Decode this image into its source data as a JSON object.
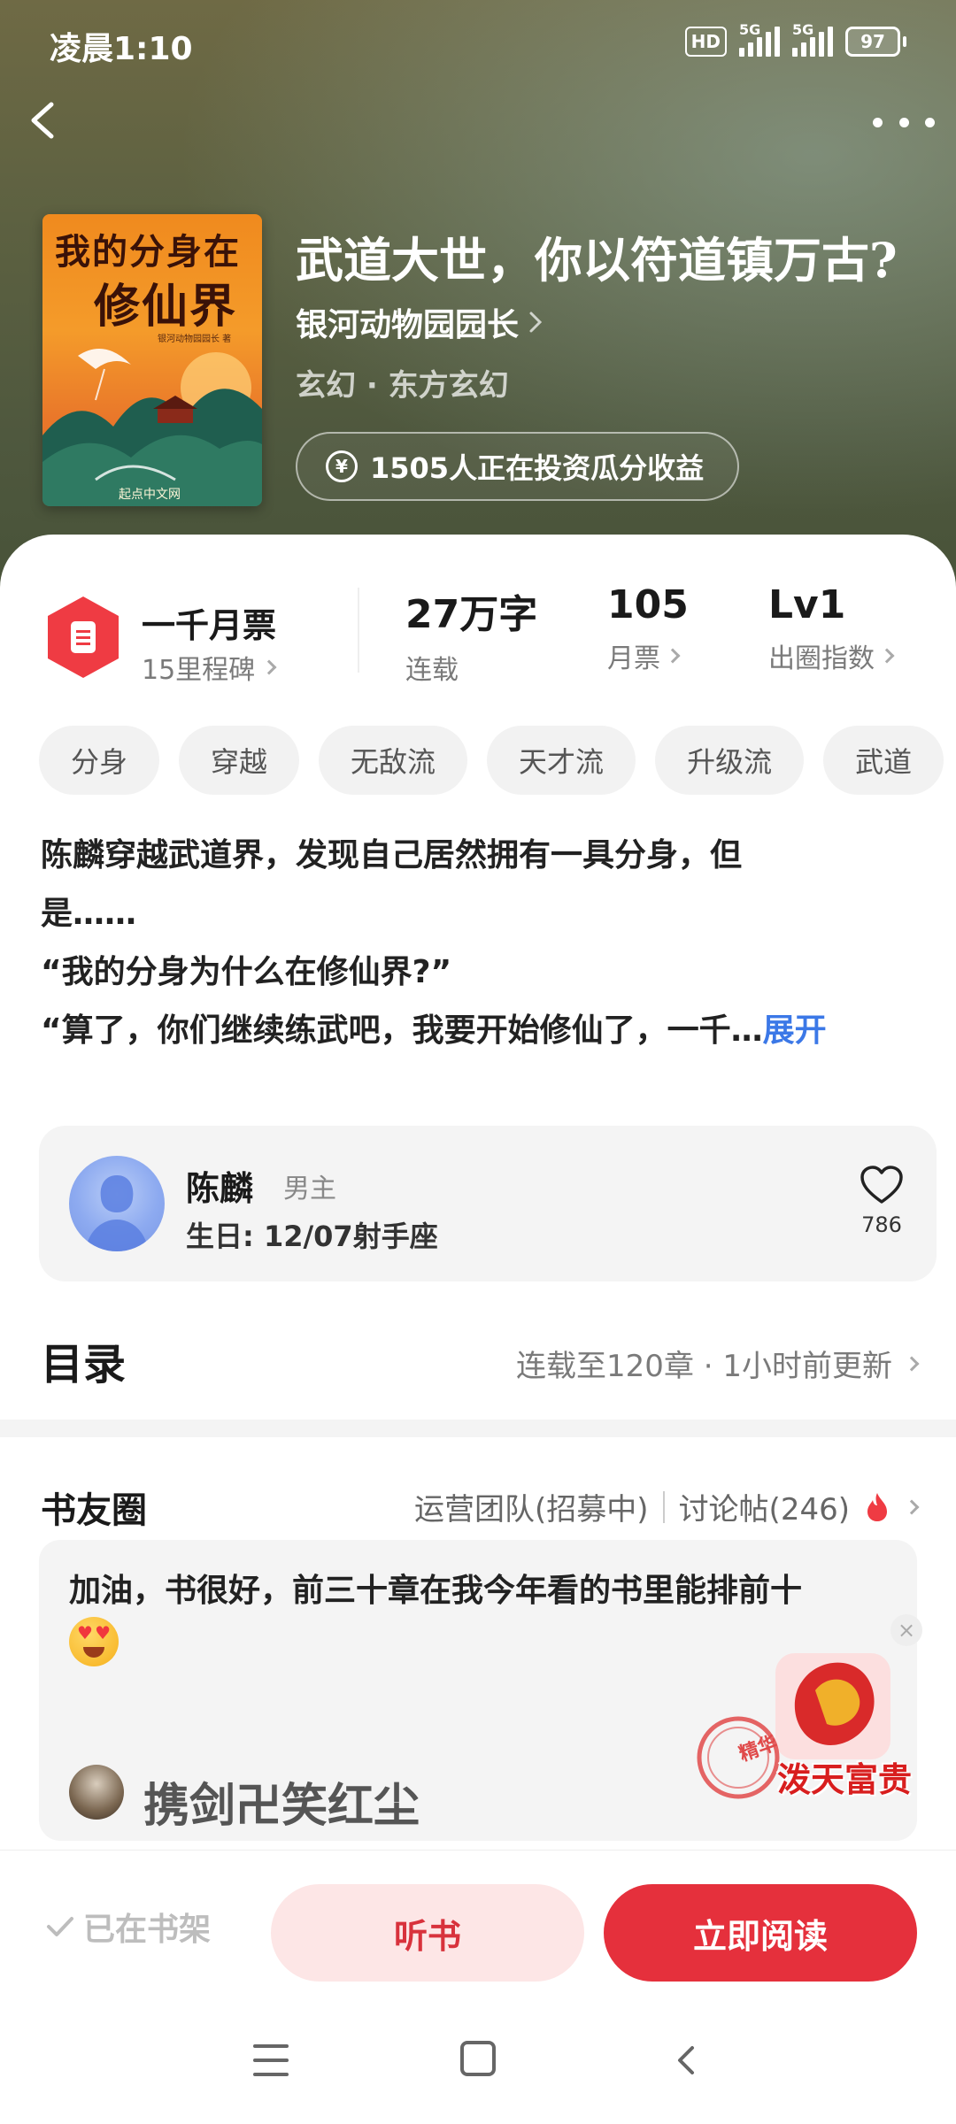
{
  "status_bar": {
    "time": "凌晨1:10",
    "hd": "HD",
    "signal1": "5G",
    "signal2": "5G",
    "battery": "97"
  },
  "book": {
    "title": "武道大世，你以符道镇万古?",
    "author": "银河动物园园长",
    "genre": "玄幻 · 东方玄幻",
    "invest_text": "1505人正在投资瓜分收益",
    "cover": {
      "title_line1": "我的分身在",
      "title_line2": "修仙界",
      "author": "银河动物园园长 著",
      "publisher": "起点中文网"
    }
  },
  "stats": {
    "ticket_title": "一千月票",
    "ticket_sub": "15里程碑",
    "words": {
      "value": "27万字",
      "label": "连载"
    },
    "monthly": {
      "value": "105",
      "label": "月票"
    },
    "level": {
      "value": "Lv1",
      "label": "出圈指数"
    }
  },
  "tags": [
    "分身",
    "穿越",
    "无敌流",
    "天才流",
    "升级流",
    "武道"
  ],
  "description": {
    "line1": "陈麟穿越武道界，发现自己居然拥有一具分身，但",
    "line2": "是……",
    "line3": "“我的分身为什么在修仙界?”",
    "line4": "“算了，你们继续练武吧，我要开始修仙了，一千…",
    "expand": "展开"
  },
  "character": {
    "name": "陈麟",
    "role": "男主",
    "birthday": "生日: 12/07射手座",
    "likes": "786"
  },
  "toc": {
    "title": "目录",
    "info": "连载至120章 · 1小时前更新"
  },
  "circle": {
    "title": "书友圈",
    "team": "运营团队(招募中)",
    "posts": "讨论帖(246)",
    "post_text": "加油，书很好，前三十章在我今年看的书里能排前十",
    "poster": "携剑卍笑红尘",
    "stamp_label": "精华",
    "stamp_title": "泼天富贵"
  },
  "bottom": {
    "shelf": "已在书架",
    "listen": "听书",
    "read": "立即阅读"
  },
  "colors": {
    "accent": "#e5303c",
    "link": "#3b78e7",
    "header_bg": "#5d6141"
  }
}
